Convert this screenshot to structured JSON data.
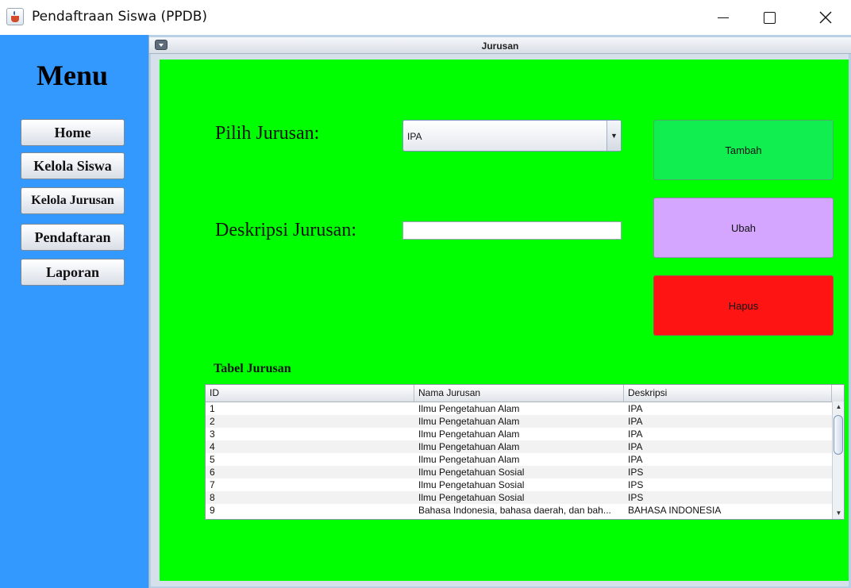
{
  "window": {
    "title": "Pendaftraan Siswa (PPDB)",
    "icons": {
      "app": "java-cup-icon",
      "minimize": "minimize-icon",
      "maximize": "maximize-icon",
      "close": "close-icon"
    }
  },
  "sidebar": {
    "title": "Menu",
    "bg_color": "#3399ff",
    "items": [
      {
        "label": "Home"
      },
      {
        "label": "Kelola Siswa"
      },
      {
        "label": "Kelola Jurusan"
      },
      {
        "label": "Pendaftaran"
      },
      {
        "label": "Laporan"
      }
    ]
  },
  "frame": {
    "title": "Jurusan",
    "bg_color": "#00ff00",
    "pilih_label": "Pilih Jurusan:",
    "pilih_value": "IPA",
    "deskripsi_label": "Deskripsi Jurusan:",
    "deskripsi_value": "",
    "buttons": {
      "tambah": "Tambah",
      "ubah": "Ubah",
      "hapus": "Hapus"
    },
    "button_colors": {
      "tambah": "#10ee50",
      "ubah": "#d4a6ff",
      "hapus": "#ff1414"
    }
  },
  "table": {
    "title": "Tabel Jurusan",
    "columns": [
      "ID",
      "Nama Jurusan",
      "Deskripsi"
    ],
    "rows": [
      [
        "1",
        "Ilmu Pengetahuan Alam",
        "IPA"
      ],
      [
        "2",
        "Ilmu Pengetahuan Alam",
        "IPA"
      ],
      [
        "3",
        "Ilmu Pengetahuan Alam",
        "IPA"
      ],
      [
        "4",
        "Ilmu Pengetahuan Alam",
        "IPA"
      ],
      [
        "5",
        "Ilmu Pengetahuan Alam",
        "IPA"
      ],
      [
        "6",
        "Ilmu Pengetahuan Sosial",
        "IPS"
      ],
      [
        "7",
        "Ilmu Pengetahuan Sosial",
        "IPS"
      ],
      [
        "8",
        "Ilmu Pengetahuan Sosial",
        "IPS"
      ],
      [
        "9",
        "Bahasa Indonesia, bahasa daerah, dan bah...",
        "BAHASA INDONESIA"
      ]
    ]
  }
}
